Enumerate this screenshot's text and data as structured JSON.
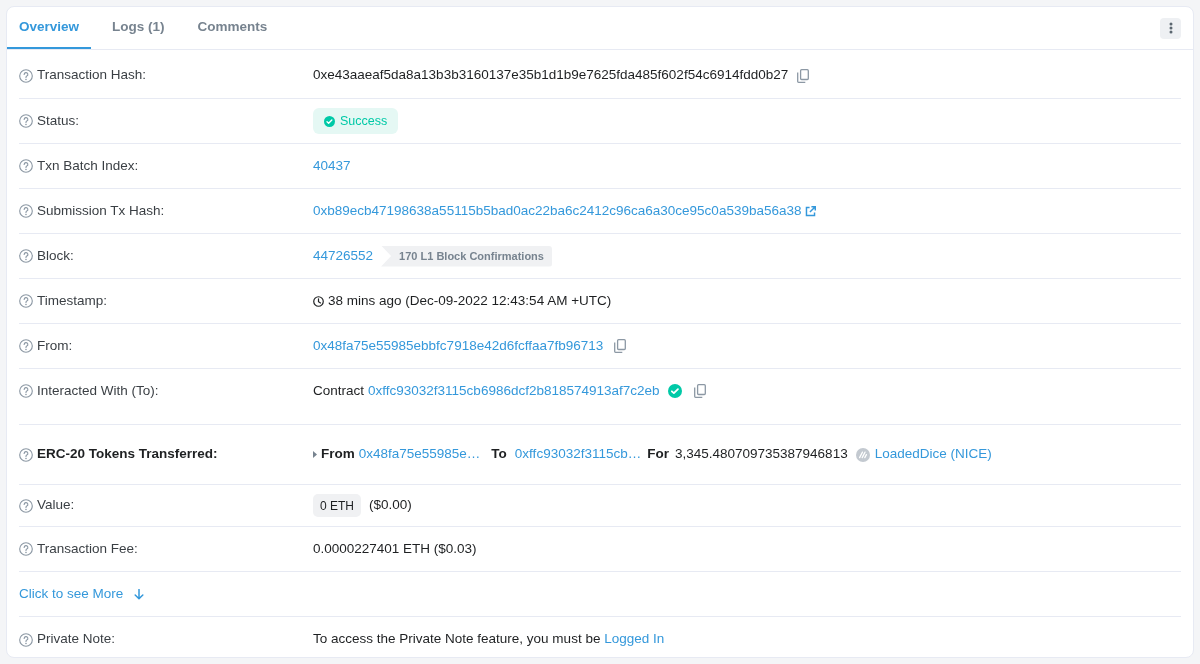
{
  "tabs": [
    {
      "label": "Overview",
      "selected": true
    },
    {
      "label": "Logs (1)",
      "selected": false
    },
    {
      "label": "Comments",
      "selected": false
    }
  ],
  "rows": [
    {
      "kind": "text",
      "label": "Transaction Hash:",
      "value": "0xe43aaeaf5da8a13b3b3160137e35b1d1b9e7625fda485f602f54c6914fdd0b27",
      "copyable": true
    },
    {
      "kind": "status",
      "label": "Status:",
      "badge": "Success"
    },
    {
      "kind": "link",
      "label": "Txn Batch Index:",
      "value": "40437"
    },
    {
      "kind": "link",
      "label": "Submission Tx Hash:",
      "value": "0xb89ecb47198638a55115b5bad0ac22ba6c2412c96ca6a30ce95c0a539ba56a38",
      "external": true
    },
    {
      "kind": "block",
      "label": "Block:",
      "value": "44726552",
      "confirmations": "170 L1 Block Confirmations"
    },
    {
      "kind": "timestamp",
      "label": "Timestamp:",
      "value": "38 mins ago (Dec-09-2022 12:43:54 AM +UTC)"
    },
    {
      "kind": "link",
      "label": "From:",
      "value": "0x48fa75e55985ebbfc7918e42d6fcffaa7fb96713",
      "copyable": true
    },
    {
      "kind": "contract",
      "label": "Interacted With (To):",
      "prefix": "Contract",
      "value": "0xffc93032f3115cb6986dcf2b818574913af7c2eb",
      "verified": true,
      "copyable": true
    },
    {
      "kind": "tokens",
      "label": "ERC-20 Tokens Transferred:",
      "from_label": "From",
      "from": "0x48fa75e55985e…",
      "to_label": "To",
      "to": "0xffc93032f3115cb…",
      "for_label": "For",
      "amount": "3,345.480709735387946813",
      "token": "LoadedDice (NICE)"
    },
    {
      "kind": "value",
      "label": "Value:",
      "badge": "0 ETH",
      "usd": "($0.00)"
    },
    {
      "kind": "text",
      "label": "Transaction Fee:",
      "value": "0.0000227401 ETH ($0.03)"
    },
    {
      "kind": "more",
      "value": "Click to see More"
    },
    {
      "kind": "note",
      "label": "Private Note:",
      "text": "To access the Private Note feature, you must be",
      "link": "Logged In"
    }
  ]
}
